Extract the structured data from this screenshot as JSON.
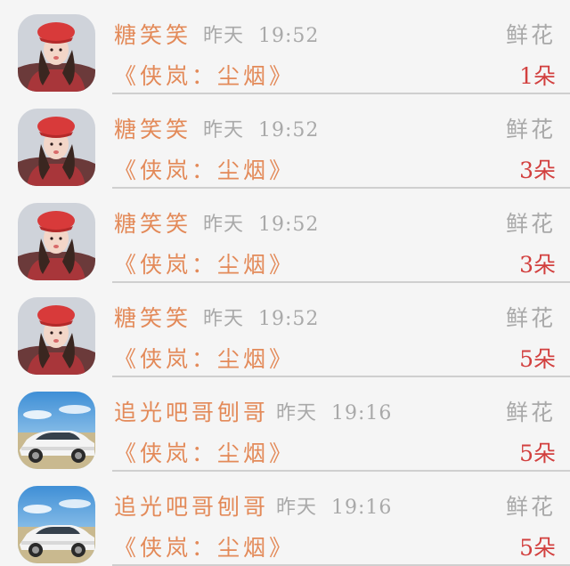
{
  "records": [
    {
      "user": "糖笑笑",
      "day": "昨天",
      "time": "19:52",
      "gift_type": "鲜花",
      "book": "《侠岚：尘烟》",
      "count": "1朵",
      "avatar": "girl-red-beret-avatar"
    },
    {
      "user": "糖笑笑",
      "day": "昨天",
      "time": "19:52",
      "gift_type": "鲜花",
      "book": "《侠岚：尘烟》",
      "count": "3朵",
      "avatar": "girl-red-beret-avatar"
    },
    {
      "user": "糖笑笑",
      "day": "昨天",
      "time": "19:52",
      "gift_type": "鲜花",
      "book": "《侠岚：尘烟》",
      "count": "3朵",
      "avatar": "girl-red-beret-avatar"
    },
    {
      "user": "糖笑笑",
      "day": "昨天",
      "time": "19:52",
      "gift_type": "鲜花",
      "book": "《侠岚：尘烟》",
      "count": "5朵",
      "avatar": "girl-red-beret-avatar"
    },
    {
      "user": "追光吧哥刨哥",
      "day": "昨天",
      "time": "19:16",
      "gift_type": "鲜花",
      "book": "《侠岚：尘烟》",
      "count": "5朵",
      "avatar": "white-car-avatar"
    },
    {
      "user": "追光吧哥刨哥",
      "day": "昨天",
      "time": "19:16",
      "gift_type": "鲜花",
      "book": "《侠岚：尘烟》",
      "count": "5朵",
      "avatar": "white-car-avatar"
    }
  ],
  "colors": {
    "name": "#e38a59",
    "meta": "#a9a9a9",
    "count": "#d2403f",
    "divider": "#cfcfcf"
  }
}
